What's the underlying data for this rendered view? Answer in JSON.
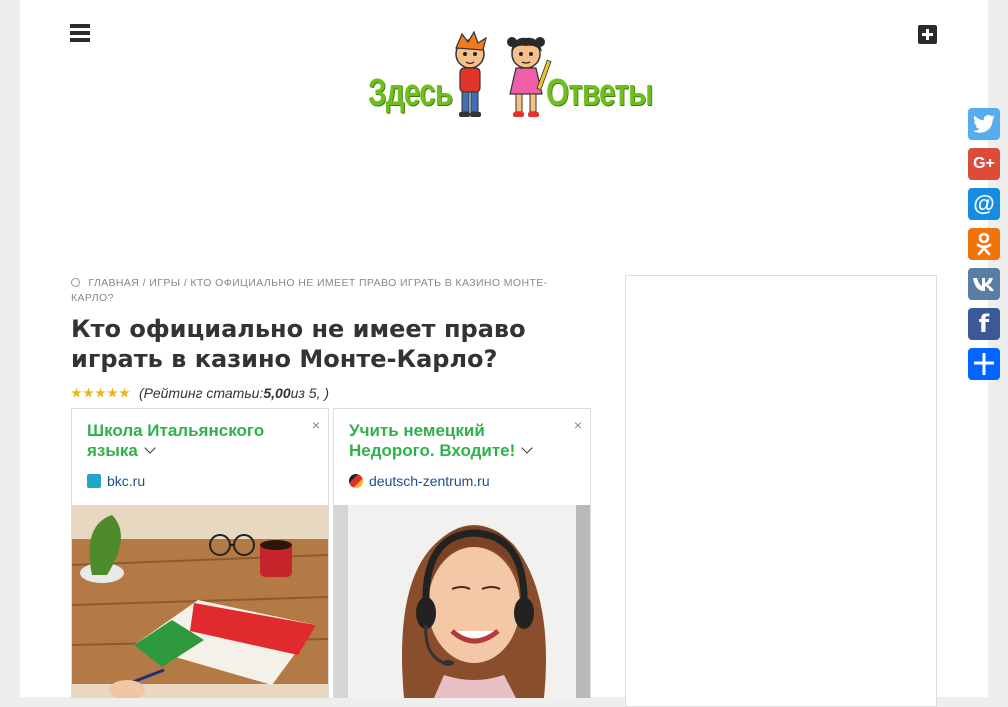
{
  "header": {
    "logo_left": "Здесь",
    "logo_right": "Ответы"
  },
  "breadcrumb": {
    "home": "Главная",
    "separator": "/",
    "category": "Игры",
    "current": "Кто официально не имеет право играть в казино Монте-Карло?"
  },
  "article": {
    "title": "Кто официально не имеет право играть в казино Монте-Карло?",
    "rating_prefix": "(",
    "rating_label": "Рейтинг статьи: ",
    "rating_value": "5,00",
    "rating_suffix": " из 5, )",
    "stars": 5
  },
  "ads": [
    {
      "title": "Школа Итальянского языка",
      "domain": "bkc.ru",
      "close": "×"
    },
    {
      "title": "Учить немецкий Недорого. Входите!",
      "domain": "deutsch-zentrum.ru",
      "close": "×"
    }
  ],
  "share": {
    "twitter_icon": "twitter-icon",
    "googleplus_icon": "google-plus-icon",
    "mail_icon": "mail-icon",
    "ok_icon": "odnoklassniki-icon",
    "vk_icon": "vk-icon",
    "facebook_icon": "facebook-icon",
    "share_icon": "share-icon",
    "googleplus_label": "G+",
    "mail_label": "@",
    "facebook_label": "f",
    "colors": {
      "twitter": "#55acee",
      "googleplus": "#dd4b39",
      "mail": "#168de2",
      "ok": "#f2720c",
      "vk": "#587ea3",
      "facebook": "#3b5998",
      "share": "#0166ff"
    }
  }
}
